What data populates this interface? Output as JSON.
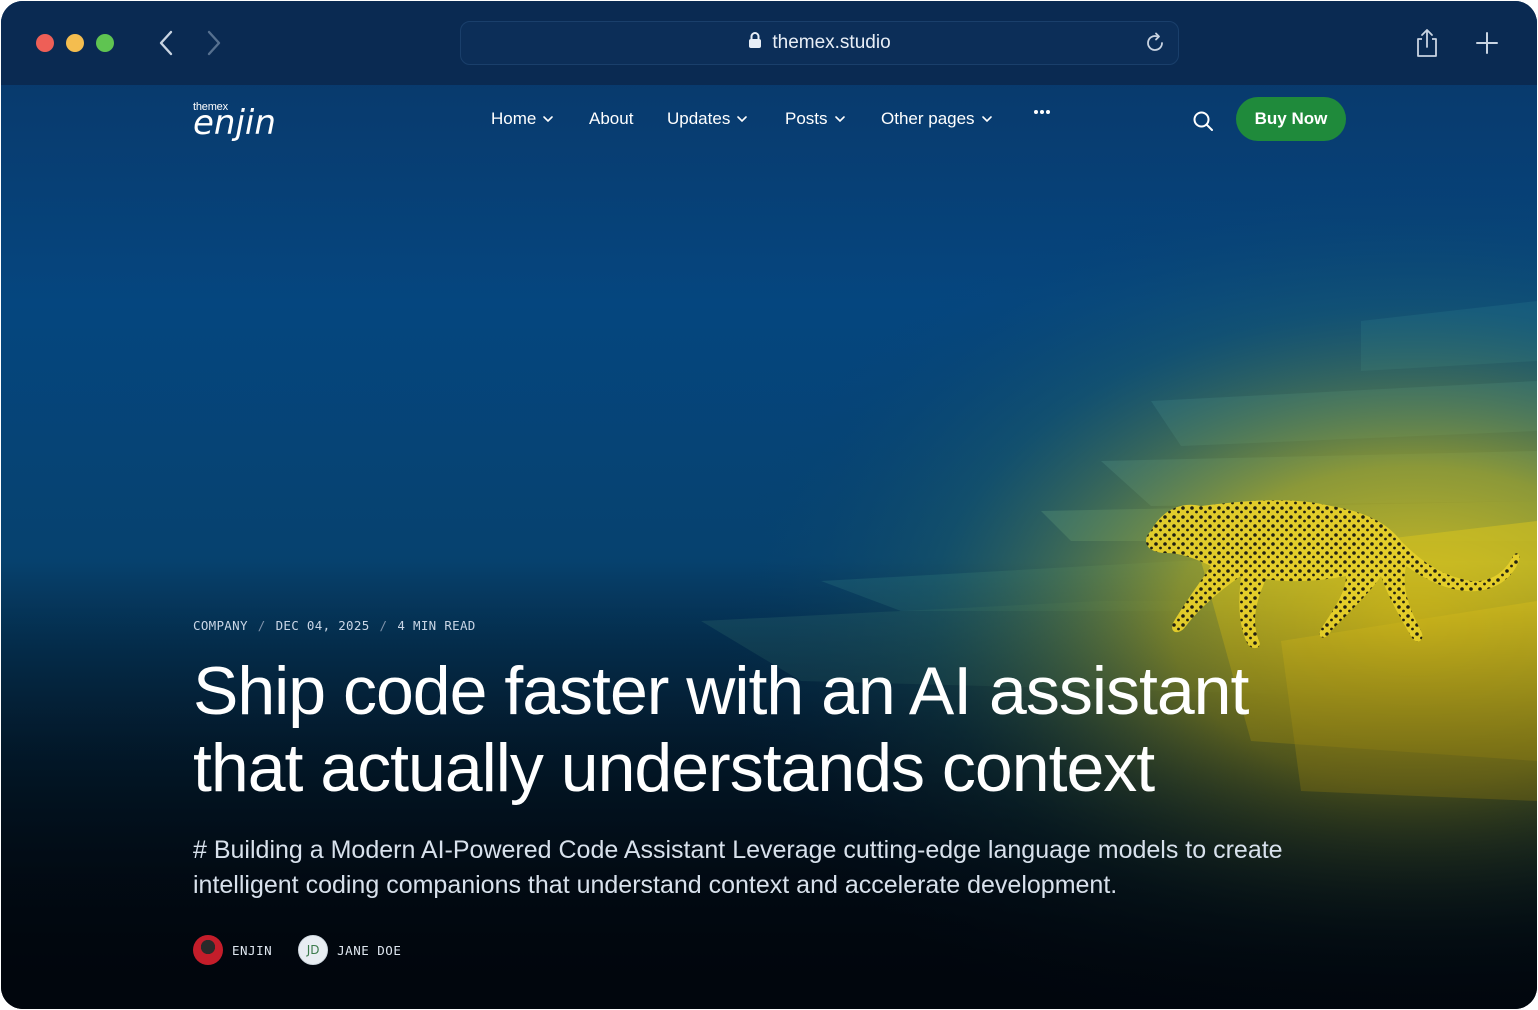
{
  "browser": {
    "url": "themex.studio",
    "traffic_lights": [
      "#ee5f57",
      "#f4bd4f",
      "#5fc451"
    ]
  },
  "site": {
    "logo_small": "themex",
    "logo_big": "enjin",
    "nav": [
      {
        "label": "Home",
        "dropdown": true
      },
      {
        "label": "About",
        "dropdown": false
      },
      {
        "label": "Updates",
        "dropdown": true
      },
      {
        "label": "Posts",
        "dropdown": true
      },
      {
        "label": "Other pages",
        "dropdown": true
      }
    ],
    "more_icon": "ellipsis-icon",
    "buy_label": "Buy Now",
    "accent": "#1f8a3b"
  },
  "article": {
    "category": "COMPANY",
    "date": "DEC 04, 2025",
    "read_time": "4 MIN READ",
    "separator": "/",
    "title_line1": "Ship code faster with an AI assistant",
    "title_line2": "that actually understands context",
    "excerpt": "# Building a Modern AI-Powered Code Assistant Leverage cutting-edge language models to create intelligent coding companions that understand context and accelerate development.",
    "authors": [
      {
        "name": "ENJIN",
        "initials": ""
      },
      {
        "name": "JANE DOE",
        "initials": "JD"
      }
    ]
  }
}
